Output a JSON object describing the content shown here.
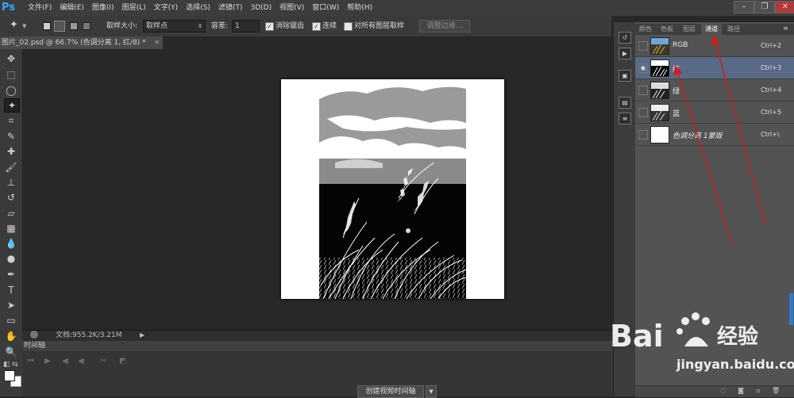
{
  "app": {
    "logo": "Ps"
  },
  "menu": [
    "文件(F)",
    "编辑(E)",
    "图像(I)",
    "图层(L)",
    "文字(Y)",
    "选择(S)",
    "滤镜(T)",
    "3D(D)",
    "视图(V)",
    "窗口(W)",
    "帮助(H)"
  ],
  "window_controls": {
    "minimize": "–",
    "restore": "❐",
    "close": "✕"
  },
  "options": {
    "sample_size_label": "取样大小:",
    "sample_size_value": "取样点",
    "tolerance_label": "容差:",
    "tolerance_value": "1",
    "antialias_label": "消除锯齿",
    "antialias_checked": true,
    "contiguous_label": "连续",
    "contiguous_checked": true,
    "all_layers_label": "对所有图层取样",
    "all_layers_checked": false,
    "refine_edge_label": "调整边缘..."
  },
  "document": {
    "tab_title": "图片_02.psd @ 66.7% (色调分离 1, 红/8) *",
    "close": "×"
  },
  "status": {
    "doc_size": "文档:955.2K/3.21M"
  },
  "timeline": {
    "title": "时间轴",
    "create_button": "创建视频时间轴"
  },
  "panel": {
    "tabs": [
      "颜色",
      "色板",
      "图层",
      "通道",
      "路径"
    ],
    "active_tab": "通道",
    "channels": [
      {
        "name": "RGB",
        "shortcut": "Ctrl+2",
        "visible": false,
        "selected": false
      },
      {
        "name": "红",
        "shortcut": "Ctrl+3",
        "visible": true,
        "selected": true
      },
      {
        "name": "绿",
        "shortcut": "Ctrl+4",
        "visible": false,
        "selected": false
      },
      {
        "name": "蓝",
        "shortcut": "Ctrl+5",
        "visible": false,
        "selected": false
      },
      {
        "name": "色调分离 1蒙版",
        "shortcut": "Ctrl+\\",
        "visible": false,
        "selected": false
      }
    ]
  },
  "annotation": {
    "arrow_color": "#cc1e1e"
  },
  "watermark": {
    "brand": "Bai 经验",
    "url": "jingyan.baidu.com"
  }
}
